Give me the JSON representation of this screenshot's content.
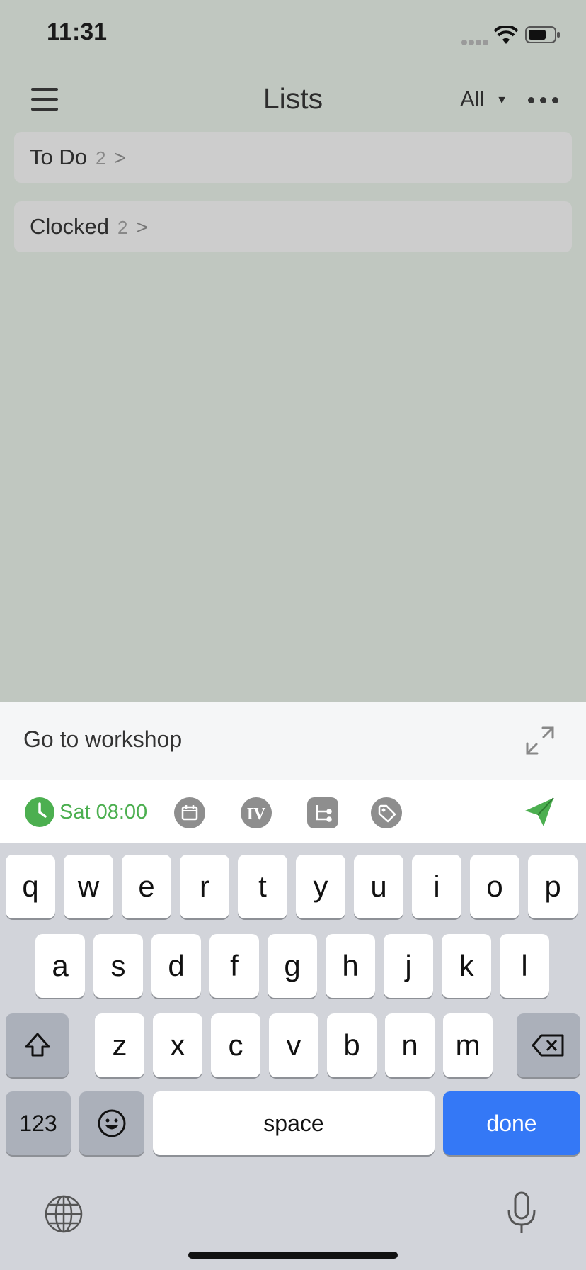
{
  "status_bar": {
    "time": "11:31"
  },
  "header": {
    "title": "Lists",
    "filter_label": "All"
  },
  "lists": [
    {
      "label": "To Do",
      "count": "2"
    },
    {
      "label": "Clocked",
      "count": "2"
    }
  ],
  "compose": {
    "task_text": "Go to workshop",
    "date_label": "Sat 08:00"
  },
  "toolbar_icons": [
    "calendar-icon",
    "priority-icon",
    "subtask-icon",
    "tag-icon"
  ],
  "keyboard": {
    "row1": [
      "q",
      "w",
      "e",
      "r",
      "t",
      "y",
      "u",
      "i",
      "o",
      "p"
    ],
    "row2": [
      "a",
      "s",
      "d",
      "f",
      "g",
      "h",
      "j",
      "k",
      "l"
    ],
    "row3": [
      "z",
      "x",
      "c",
      "v",
      "b",
      "n",
      "m"
    ],
    "numbers_label": "123",
    "space_label": "space",
    "done_label": "done"
  },
  "colors": {
    "accent_green": "#4caf50",
    "done_blue": "#3478f6",
    "overlay": "#c0c7c0"
  }
}
